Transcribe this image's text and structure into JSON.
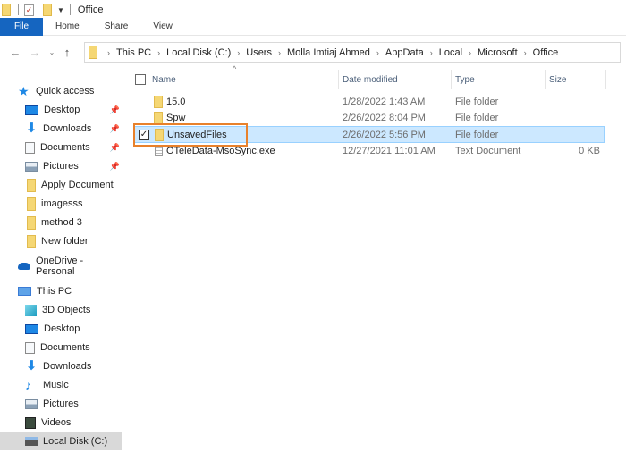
{
  "window": {
    "title": "Office"
  },
  "ribbon": {
    "tabs": [
      "File",
      "Home",
      "Share",
      "View"
    ]
  },
  "address_bar": {
    "crumbs": [
      "This PC",
      "Local Disk (C:)",
      "Users",
      "Molla Imtiaj Ahmed",
      "AppData",
      "Local",
      "Microsoft",
      "Office"
    ]
  },
  "sidebar": {
    "quick_access": {
      "label": "Quick access",
      "items": [
        {
          "label": "Desktop",
          "icon": "desktop-icon",
          "pinned": true
        },
        {
          "label": "Downloads",
          "icon": "downloads-icon",
          "pinned": true
        },
        {
          "label": "Documents",
          "icon": "documents-icon",
          "pinned": true
        },
        {
          "label": "Pictures",
          "icon": "pictures-icon",
          "pinned": true
        },
        {
          "label": "Apply Document",
          "icon": "folder-icon",
          "pinned": false
        },
        {
          "label": "imagesss",
          "icon": "folder-icon",
          "pinned": false
        },
        {
          "label": "method 3",
          "icon": "folder-icon",
          "pinned": false
        },
        {
          "label": "New folder",
          "icon": "folder-icon",
          "pinned": false
        }
      ]
    },
    "onedrive": {
      "label": "OneDrive - Personal"
    },
    "this_pc": {
      "label": "This PC",
      "items": [
        {
          "label": "3D Objects",
          "icon": "3d-objects-icon"
        },
        {
          "label": "Desktop",
          "icon": "desktop-icon"
        },
        {
          "label": "Documents",
          "icon": "documents-icon"
        },
        {
          "label": "Downloads",
          "icon": "downloads-icon"
        },
        {
          "label": "Music",
          "icon": "music-icon"
        },
        {
          "label": "Pictures",
          "icon": "pictures-icon"
        },
        {
          "label": "Videos",
          "icon": "videos-icon"
        },
        {
          "label": "Local Disk (C:)",
          "icon": "local-disk-icon",
          "selected": true
        }
      ]
    }
  },
  "file_list": {
    "columns": [
      "Name",
      "Date modified",
      "Type",
      "Size"
    ],
    "rows": [
      {
        "name": "15.0",
        "date": "1/28/2022 1:43 AM",
        "type": "File folder",
        "size": "",
        "icon": "folder-icon",
        "selected": false
      },
      {
        "name": "Spw",
        "date": "2/26/2022 8:04 PM",
        "type": "File folder",
        "size": "",
        "icon": "folder-icon",
        "selected": false
      },
      {
        "name": "UnsavedFiles",
        "date": "2/26/2022 5:56 PM",
        "type": "File folder",
        "size": "",
        "icon": "folder-icon",
        "selected": true
      },
      {
        "name": "OTeleData-MsoSync.exe",
        "date": "12/27/2021 11:01 AM",
        "type": "Text Document",
        "size": "0 KB",
        "icon": "text-file-icon",
        "selected": false
      }
    ]
  },
  "colors": {
    "file_tab": "#1565c0",
    "selection": "#cce8ff",
    "highlight_box": "#e8812b"
  }
}
